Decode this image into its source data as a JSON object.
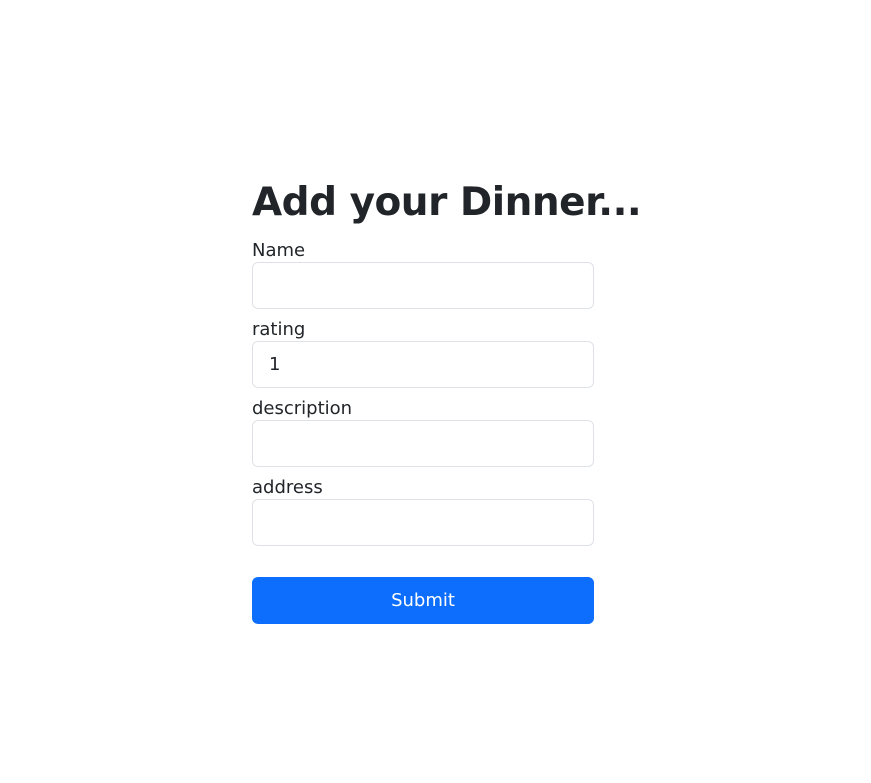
{
  "form": {
    "title": "Add your Dinner...",
    "fields": [
      {
        "label": "Name",
        "value": "",
        "placeholder": ""
      },
      {
        "label": "rating",
        "value": "1",
        "placeholder": ""
      },
      {
        "label": "description",
        "value": "",
        "placeholder": ""
      },
      {
        "label": "address",
        "value": "",
        "placeholder": ""
      }
    ],
    "submit_label": "Submit"
  },
  "colors": {
    "primary": "#0d6efd",
    "text": "#212529",
    "border": "#dee2e6",
    "background": "#ffffff"
  }
}
